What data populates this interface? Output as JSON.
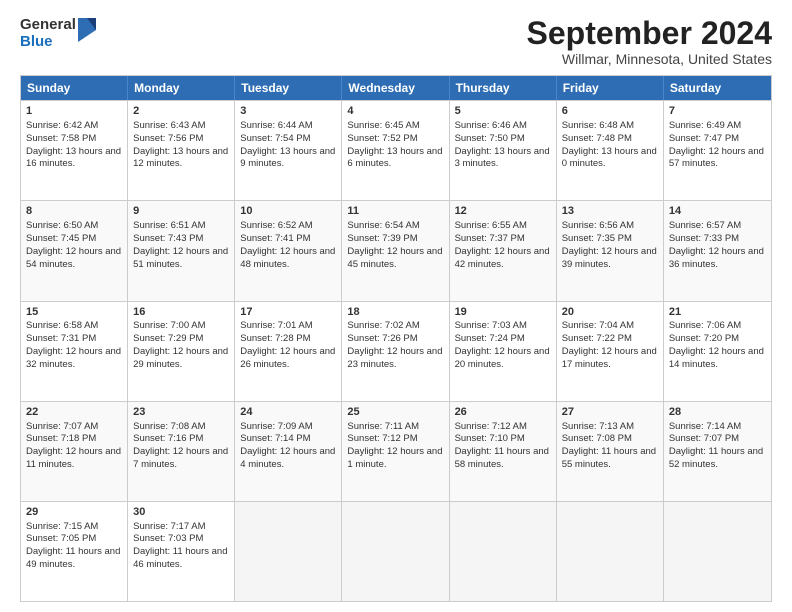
{
  "header": {
    "logo_general": "General",
    "logo_blue": "Blue",
    "month_title": "September 2024",
    "location": "Willmar, Minnesota, United States"
  },
  "calendar": {
    "days": [
      "Sunday",
      "Monday",
      "Tuesday",
      "Wednesday",
      "Thursday",
      "Friday",
      "Saturday"
    ],
    "rows": [
      [
        {
          "day": "1",
          "sunrise": "6:42 AM",
          "sunset": "7:58 PM",
          "daylight": "13 hours and 16 minutes."
        },
        {
          "day": "2",
          "sunrise": "6:43 AM",
          "sunset": "7:56 PM",
          "daylight": "13 hours and 12 minutes."
        },
        {
          "day": "3",
          "sunrise": "6:44 AM",
          "sunset": "7:54 PM",
          "daylight": "13 hours and 9 minutes."
        },
        {
          "day": "4",
          "sunrise": "6:45 AM",
          "sunset": "7:52 PM",
          "daylight": "13 hours and 6 minutes."
        },
        {
          "day": "5",
          "sunrise": "6:46 AM",
          "sunset": "7:50 PM",
          "daylight": "13 hours and 3 minutes."
        },
        {
          "day": "6",
          "sunrise": "6:48 AM",
          "sunset": "7:48 PM",
          "daylight": "13 hours and 0 minutes."
        },
        {
          "day": "7",
          "sunrise": "6:49 AM",
          "sunset": "7:47 PM",
          "daylight": "12 hours and 57 minutes."
        }
      ],
      [
        {
          "day": "8",
          "sunrise": "6:50 AM",
          "sunset": "7:45 PM",
          "daylight": "12 hours and 54 minutes."
        },
        {
          "day": "9",
          "sunrise": "6:51 AM",
          "sunset": "7:43 PM",
          "daylight": "12 hours and 51 minutes."
        },
        {
          "day": "10",
          "sunrise": "6:52 AM",
          "sunset": "7:41 PM",
          "daylight": "12 hours and 48 minutes."
        },
        {
          "day": "11",
          "sunrise": "6:54 AM",
          "sunset": "7:39 PM",
          "daylight": "12 hours and 45 minutes."
        },
        {
          "day": "12",
          "sunrise": "6:55 AM",
          "sunset": "7:37 PM",
          "daylight": "12 hours and 42 minutes."
        },
        {
          "day": "13",
          "sunrise": "6:56 AM",
          "sunset": "7:35 PM",
          "daylight": "12 hours and 39 minutes."
        },
        {
          "day": "14",
          "sunrise": "6:57 AM",
          "sunset": "7:33 PM",
          "daylight": "12 hours and 36 minutes."
        }
      ],
      [
        {
          "day": "15",
          "sunrise": "6:58 AM",
          "sunset": "7:31 PM",
          "daylight": "12 hours and 32 minutes."
        },
        {
          "day": "16",
          "sunrise": "7:00 AM",
          "sunset": "7:29 PM",
          "daylight": "12 hours and 29 minutes."
        },
        {
          "day": "17",
          "sunrise": "7:01 AM",
          "sunset": "7:28 PM",
          "daylight": "12 hours and 26 minutes."
        },
        {
          "day": "18",
          "sunrise": "7:02 AM",
          "sunset": "7:26 PM",
          "daylight": "12 hours and 23 minutes."
        },
        {
          "day": "19",
          "sunrise": "7:03 AM",
          "sunset": "7:24 PM",
          "daylight": "12 hours and 20 minutes."
        },
        {
          "day": "20",
          "sunrise": "7:04 AM",
          "sunset": "7:22 PM",
          "daylight": "12 hours and 17 minutes."
        },
        {
          "day": "21",
          "sunrise": "7:06 AM",
          "sunset": "7:20 PM",
          "daylight": "12 hours and 14 minutes."
        }
      ],
      [
        {
          "day": "22",
          "sunrise": "7:07 AM",
          "sunset": "7:18 PM",
          "daylight": "12 hours and 11 minutes."
        },
        {
          "day": "23",
          "sunrise": "7:08 AM",
          "sunset": "7:16 PM",
          "daylight": "12 hours and 7 minutes."
        },
        {
          "day": "24",
          "sunrise": "7:09 AM",
          "sunset": "7:14 PM",
          "daylight": "12 hours and 4 minutes."
        },
        {
          "day": "25",
          "sunrise": "7:11 AM",
          "sunset": "7:12 PM",
          "daylight": "12 hours and 1 minute."
        },
        {
          "day": "26",
          "sunrise": "7:12 AM",
          "sunset": "7:10 PM",
          "daylight": "11 hours and 58 minutes."
        },
        {
          "day": "27",
          "sunrise": "7:13 AM",
          "sunset": "7:08 PM",
          "daylight": "11 hours and 55 minutes."
        },
        {
          "day": "28",
          "sunrise": "7:14 AM",
          "sunset": "7:07 PM",
          "daylight": "11 hours and 52 minutes."
        }
      ],
      [
        {
          "day": "29",
          "sunrise": "7:15 AM",
          "sunset": "7:05 PM",
          "daylight": "11 hours and 49 minutes."
        },
        {
          "day": "30",
          "sunrise": "7:17 AM",
          "sunset": "7:03 PM",
          "daylight": "11 hours and 46 minutes."
        },
        null,
        null,
        null,
        null,
        null
      ]
    ]
  }
}
